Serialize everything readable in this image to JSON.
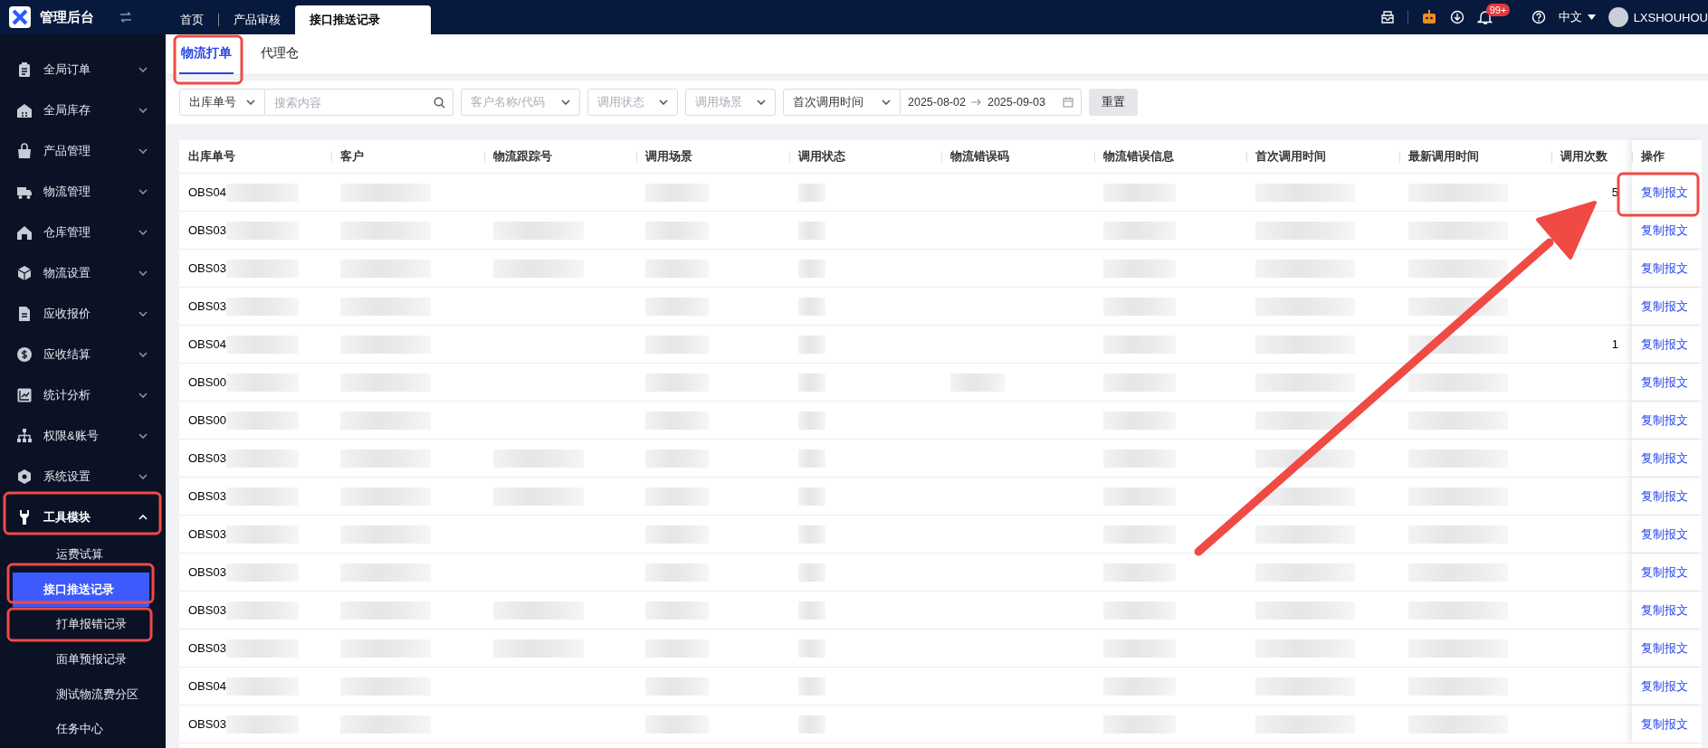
{
  "app": {
    "title": "管理后台"
  },
  "top_tabs": [
    {
      "label": "首页",
      "selected": false
    },
    {
      "label": "产品审核",
      "selected": false
    },
    {
      "label": "接口推送记录",
      "selected": true
    }
  ],
  "header": {
    "notification_badge": "99+",
    "language": "中文",
    "username": "LXSHOUHOU"
  },
  "sidebar": {
    "items": [
      {
        "label": "全局订单",
        "expanded": false
      },
      {
        "label": "全局库存",
        "expanded": false
      },
      {
        "label": "产品管理",
        "expanded": false
      },
      {
        "label": "物流管理",
        "expanded": false
      },
      {
        "label": "仓库管理",
        "expanded": false
      },
      {
        "label": "物流设置",
        "expanded": false
      },
      {
        "label": "应收报价",
        "expanded": false
      },
      {
        "label": "应收结算",
        "expanded": false
      },
      {
        "label": "统计分析",
        "expanded": false
      },
      {
        "label": "权限&账号",
        "expanded": false
      },
      {
        "label": "系统设置",
        "expanded": false
      },
      {
        "label": "工具模块",
        "expanded": true,
        "children": [
          {
            "label": "运费试算",
            "selected": false
          },
          {
            "label": "接口推送记录",
            "selected": true
          },
          {
            "label": "打单报错记录",
            "selected": false
          },
          {
            "label": "面单预报记录",
            "selected": false
          },
          {
            "label": "测试物流费分区",
            "selected": false
          },
          {
            "label": "任务中心",
            "selected": false
          }
        ]
      }
    ]
  },
  "sub_tabs": [
    {
      "label": "物流打单",
      "selected": true
    },
    {
      "label": "代理仓",
      "selected": false
    }
  ],
  "filters": {
    "search_type": {
      "value": "出库单号"
    },
    "search": {
      "placeholder": "搜索内容"
    },
    "customer": {
      "placeholder": "客户名称/代码"
    },
    "call_status": {
      "placeholder": "调用状态"
    },
    "call_scene": {
      "placeholder": "调用场景"
    },
    "date_type": {
      "value": "首次调用时间"
    },
    "date_range": {
      "start": "2025-08-02",
      "end": "2025-09-03"
    },
    "reset_button": "重置"
  },
  "table": {
    "columns": [
      "出库单号",
      "客户",
      "物流跟踪号",
      "调用场景",
      "调用状态",
      "物流错误码",
      "物流错误信息",
      "首次调用时间",
      "最新调用时间",
      "调用次数",
      "操作"
    ],
    "rows": [
      {
        "order_no": "OBS04",
        "count": "5",
        "action": "复制报文"
      },
      {
        "order_no": "OBS03",
        "action": "复制报文"
      },
      {
        "order_no": "OBS03",
        "action": "复制报文"
      },
      {
        "order_no": "OBS03",
        "action": "复制报文"
      },
      {
        "order_no": "OBS04",
        "count": "1",
        "action": "复制报文"
      },
      {
        "order_no": "OBS00",
        "action": "复制报文"
      },
      {
        "order_no": "OBS00",
        "action": "复制报文"
      },
      {
        "order_no": "OBS03",
        "action": "复制报文"
      },
      {
        "order_no": "OBS03",
        "action": "复制报文"
      },
      {
        "order_no": "OBS03",
        "action": "复制报文"
      },
      {
        "order_no": "OBS03",
        "action": "复制报文"
      },
      {
        "order_no": "OBS03",
        "action": "复制报文"
      },
      {
        "order_no": "OBS03",
        "action": "复制报文"
      },
      {
        "order_no": "OBS04",
        "action": "复制报文"
      },
      {
        "order_no": "OBS03",
        "action": "复制报文"
      }
    ]
  }
}
